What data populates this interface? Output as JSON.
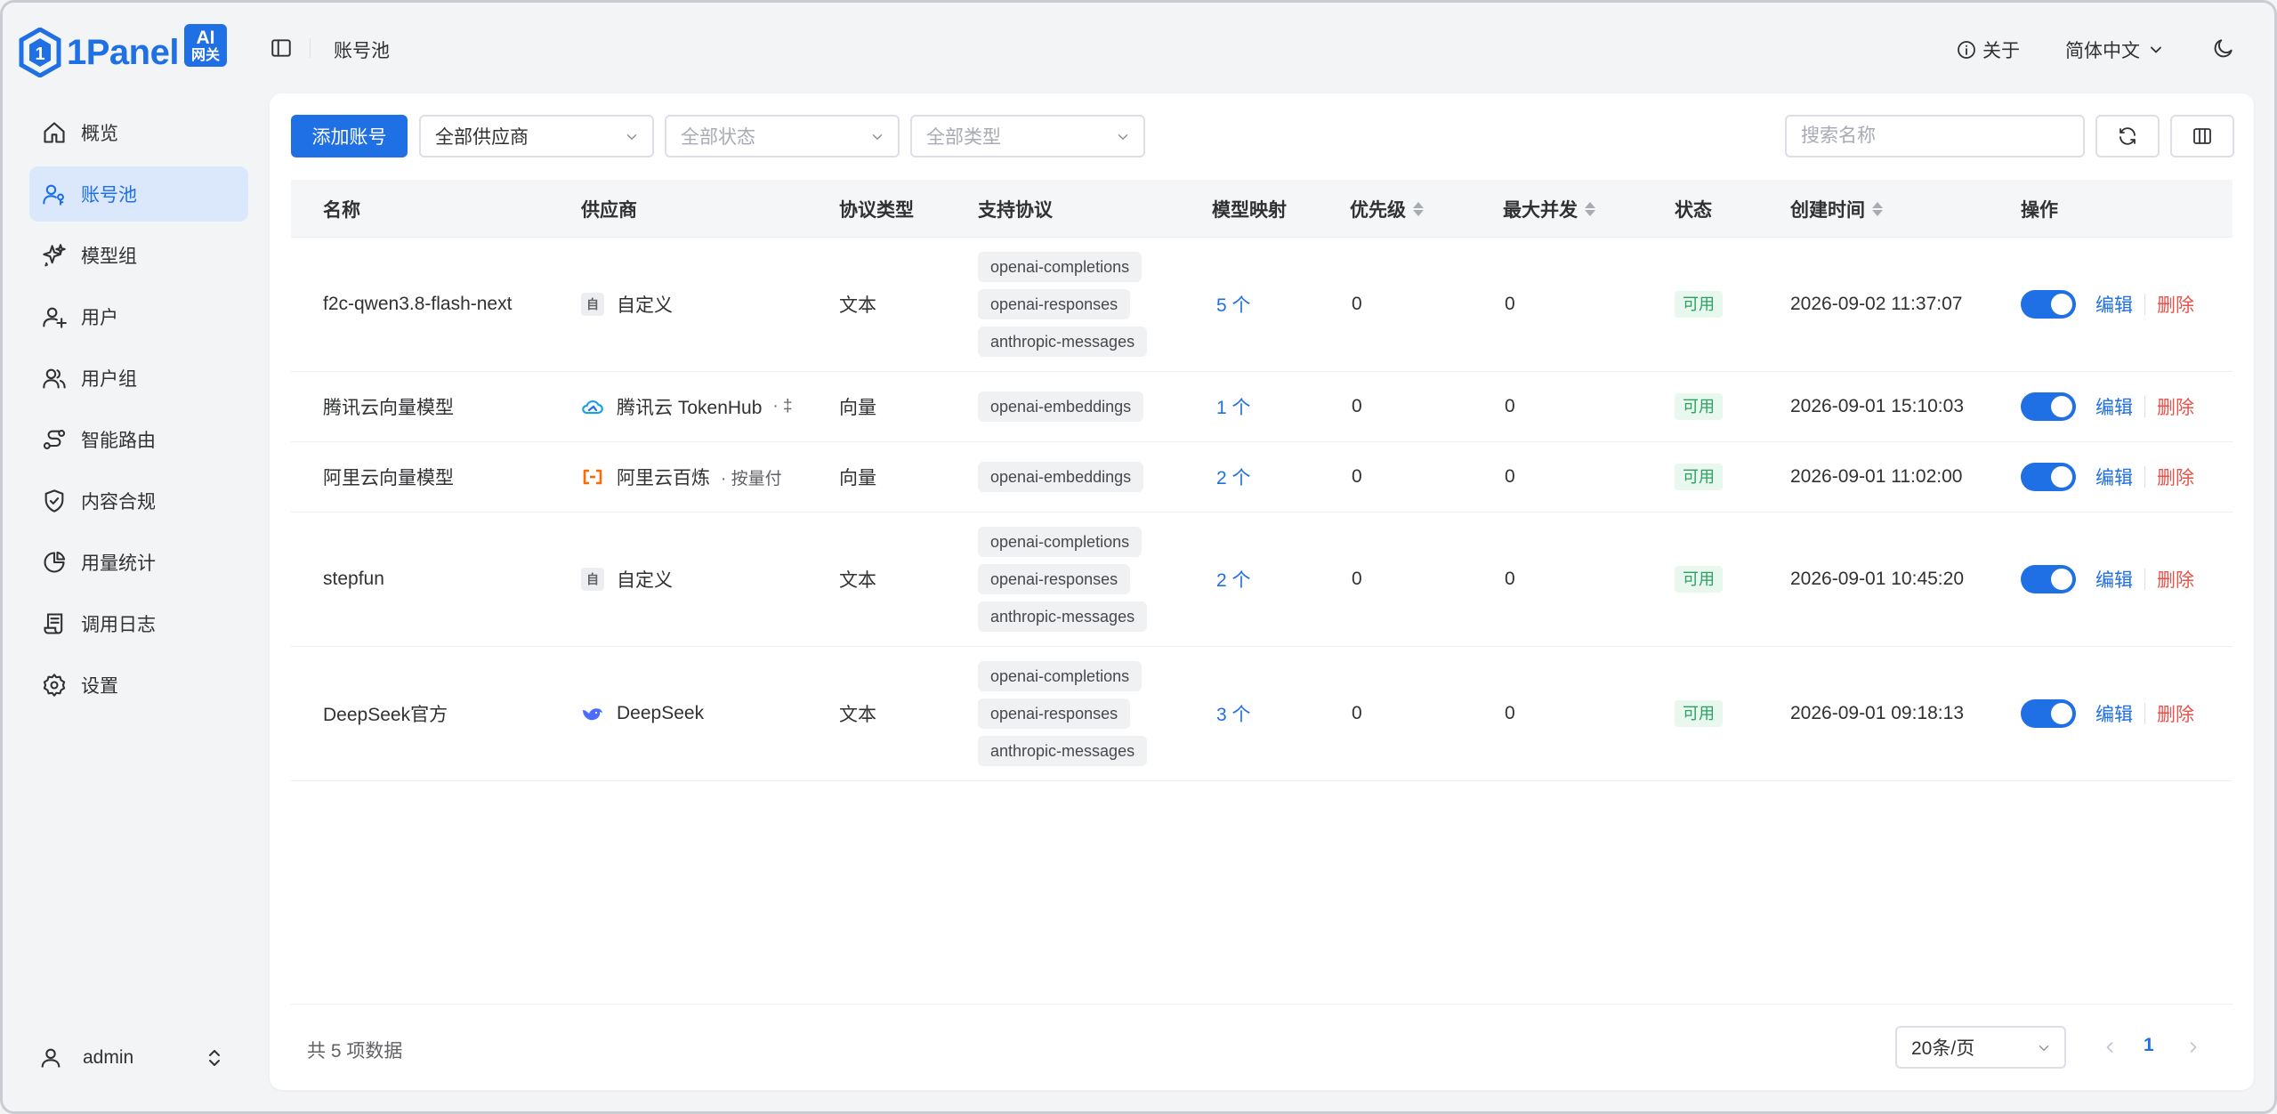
{
  "brand": {
    "name": "1Panel",
    "badge_top": "AI",
    "badge_bottom": "网关"
  },
  "sidebar": {
    "items": [
      {
        "label": "概览",
        "icon": "home-icon"
      },
      {
        "label": "账号池",
        "icon": "user-key-icon",
        "active": true
      },
      {
        "label": "模型组",
        "icon": "sparkle-icon"
      },
      {
        "label": "用户",
        "icon": "user-plus-icon"
      },
      {
        "label": "用户组",
        "icon": "users-icon"
      },
      {
        "label": "智能路由",
        "icon": "route-icon"
      },
      {
        "label": "内容合规",
        "icon": "shield-check-icon"
      },
      {
        "label": "用量统计",
        "icon": "pie-chart-icon"
      },
      {
        "label": "调用日志",
        "icon": "scroll-icon"
      },
      {
        "label": "设置",
        "icon": "gear-icon"
      }
    ],
    "user": "admin"
  },
  "topbar": {
    "breadcrumb": "账号池",
    "about": "关于",
    "language": "简体中文"
  },
  "toolbar": {
    "add_label": "添加账号",
    "provider_filter": "全部供应商",
    "status_placeholder": "全部状态",
    "type_placeholder": "全部类型",
    "search_placeholder": "搜索名称"
  },
  "table": {
    "columns": [
      "名称",
      "供应商",
      "协议类型",
      "支持协议",
      "模型映射",
      "优先级",
      "最大并发",
      "状态",
      "创建时间",
      "操作"
    ],
    "rows": [
      {
        "name": "f2c-qwen3.8-flash-next",
        "provider": "自定义",
        "provider_icon": "custom-icon",
        "billing": "",
        "type": "文本",
        "protocols": [
          "openai-completions",
          "openai-responses",
          "anthropic-messages"
        ],
        "mapping": "5 个",
        "priority": "0",
        "concurrency": "0",
        "status": "可用",
        "created": "2026-09-02 11:37:07",
        "enabled": true
      },
      {
        "name": "腾讯云向量模型",
        "provider": "腾讯云 TokenHub",
        "provider_icon": "tencent-cloud-icon",
        "billing": "· ‡",
        "type": "向量",
        "protocols": [
          "openai-embeddings"
        ],
        "mapping": "1 个",
        "priority": "0",
        "concurrency": "0",
        "status": "可用",
        "created": "2026-09-01 15:10:03",
        "enabled": true
      },
      {
        "name": "阿里云向量模型",
        "provider": "阿里云百炼",
        "provider_icon": "aliyun-icon",
        "billing": "· 按量付",
        "type": "向量",
        "protocols": [
          "openai-embeddings"
        ],
        "mapping": "2 个",
        "priority": "0",
        "concurrency": "0",
        "status": "可用",
        "created": "2026-09-01 11:02:00",
        "enabled": true
      },
      {
        "name": "stepfun",
        "provider": "自定义",
        "provider_icon": "custom-icon",
        "billing": "",
        "type": "文本",
        "protocols": [
          "openai-completions",
          "openai-responses",
          "anthropic-messages"
        ],
        "mapping": "2 个",
        "priority": "0",
        "concurrency": "0",
        "status": "可用",
        "created": "2026-09-01 10:45:20",
        "enabled": true
      },
      {
        "name": "DeepSeek官方",
        "provider": "DeepSeek",
        "provider_icon": "deepseek-whale-icon",
        "billing": "",
        "type": "文本",
        "protocols": [
          "openai-completions",
          "openai-responses",
          "anthropic-messages"
        ],
        "mapping": "3 个",
        "priority": "0",
        "concurrency": "0",
        "status": "可用",
        "created": "2026-09-01 09:18:13",
        "enabled": true
      }
    ],
    "actions": {
      "edit": "编辑",
      "delete": "删除"
    },
    "custom_icon_char": "自"
  },
  "pagination": {
    "total_text": "共 5 项数据",
    "page_size": "20条/页",
    "current_page": "1"
  },
  "colors": {
    "accent": "#1f6fe5",
    "success": "#2ba061",
    "danger": "#e5534b"
  }
}
